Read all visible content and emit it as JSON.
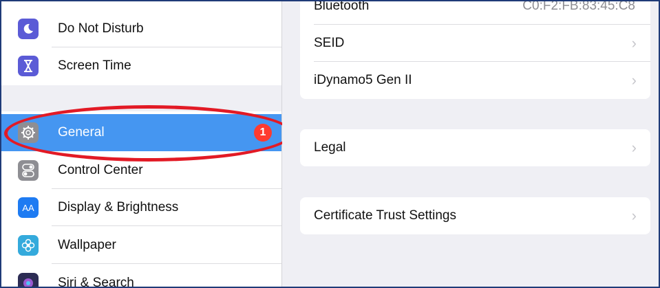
{
  "sidebar": {
    "items": [
      {
        "label": "Do Not Disturb",
        "icon": "moon-icon",
        "color": "#5b5bd6"
      },
      {
        "label": "Screen Time",
        "icon": "hourglass-icon",
        "color": "#5b5bd6"
      },
      {
        "label": "General",
        "icon": "gear-icon",
        "color": "#8e8e93",
        "badge": "1",
        "selected": true
      },
      {
        "label": "Control Center",
        "icon": "toggles-icon",
        "color": "#8e8e93"
      },
      {
        "label": "Display & Brightness",
        "icon": "text-size-icon",
        "color": "#1e7bf2",
        "glyph": "AA"
      },
      {
        "label": "Wallpaper",
        "icon": "flower-icon",
        "color": "#34aadc"
      },
      {
        "label": "Siri & Search",
        "icon": "siri-icon",
        "color": "#2c2c54"
      }
    ]
  },
  "main": {
    "group1": {
      "bluetooth": {
        "label": "Bluetooth",
        "value": "C0:F2:FB:83:45:C8"
      },
      "seid": {
        "label": "SEID"
      },
      "idynamo": {
        "label": "iDynamo5 Gen II"
      }
    },
    "legal": {
      "label": "Legal"
    },
    "cert": {
      "label": "Certificate Trust Settings"
    },
    "chevron": "›"
  }
}
